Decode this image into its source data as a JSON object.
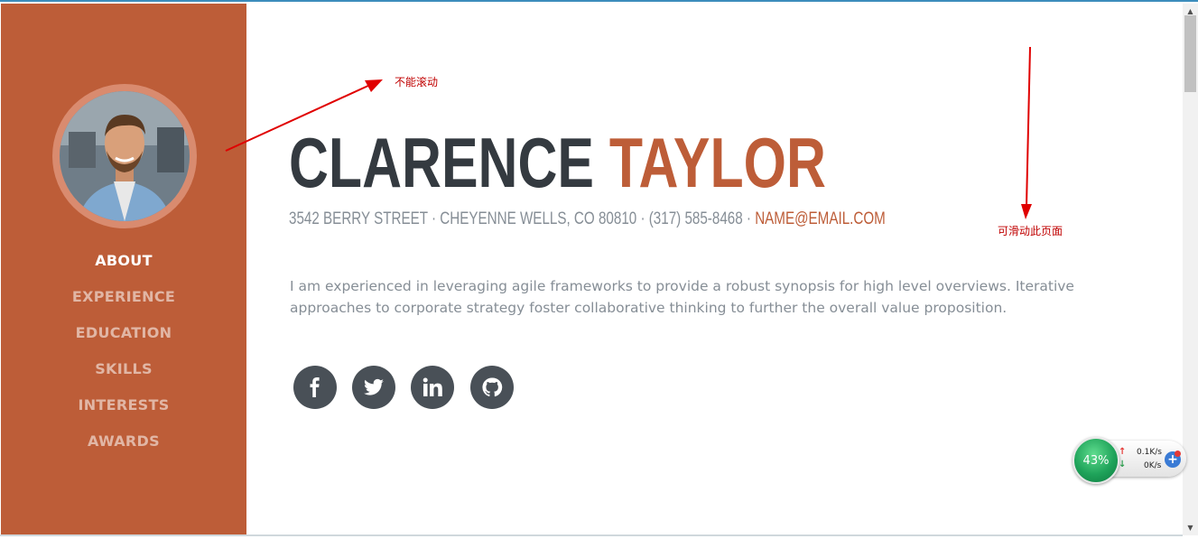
{
  "profile": {
    "first_name": "CLARENCE",
    "last_name": "TAYLOR",
    "address_line": "3542 BERRY STREET · CHEYENNE WELLS, CO 80810 · (317) 585-8468 · ",
    "email": "NAME@EMAIL.COM",
    "bio": "I am experienced in leveraging agile frameworks to provide a robust synopsis for high level overviews. Iterative approaches to corporate strategy foster collaborative thinking to further the overall value proposition."
  },
  "nav": {
    "items": [
      {
        "label": "ABOUT",
        "active": true
      },
      {
        "label": "EXPERIENCE",
        "active": false
      },
      {
        "label": "EDUCATION",
        "active": false
      },
      {
        "label": "SKILLS",
        "active": false
      },
      {
        "label": "INTERESTS",
        "active": false
      },
      {
        "label": "AWARDS",
        "active": false
      }
    ]
  },
  "socials": [
    {
      "icon": "facebook-icon"
    },
    {
      "icon": "twitter-icon"
    },
    {
      "icon": "linkedin-icon"
    },
    {
      "icon": "github-icon"
    }
  ],
  "annotations": {
    "no_scroll": "不能滚动",
    "can_scroll": "可滑动此页面"
  },
  "net_widget": {
    "percent": "43%",
    "upload": "0.1K/s",
    "download": "0K/s"
  },
  "colors": {
    "accent": "#bd5d38",
    "dark": "#343a40",
    "muted": "#868e96",
    "annotation": "#e00000"
  }
}
